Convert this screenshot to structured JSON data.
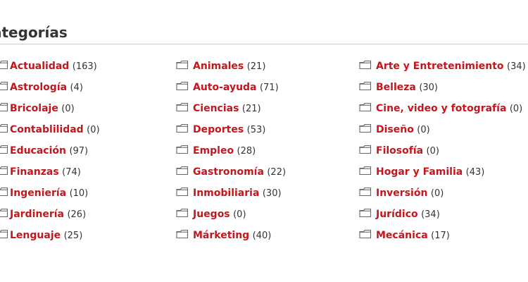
{
  "title": "ategorías",
  "categories": [
    {
      "name": "Actualidad",
      "count": "(163)"
    },
    {
      "name": "Animales",
      "count": "(21)"
    },
    {
      "name": "Arte y Entretenimiento",
      "count": "(34)"
    },
    {
      "name": "Astrología",
      "count": "(4)"
    },
    {
      "name": "Auto-ayuda",
      "count": "(71)"
    },
    {
      "name": "Belleza",
      "count": "(30)"
    },
    {
      "name": "Bricolaje",
      "count": "(0)"
    },
    {
      "name": "Ciencias",
      "count": "(21)"
    },
    {
      "name": "Cine, video y fotografía",
      "count": "(0)"
    },
    {
      "name": "Contablilidad",
      "count": "(0)"
    },
    {
      "name": "Deportes",
      "count": "(53)"
    },
    {
      "name": "Diseño",
      "count": "(0)"
    },
    {
      "name": "Educación",
      "count": "(97)"
    },
    {
      "name": "Empleo",
      "count": "(28)"
    },
    {
      "name": "Filosofía",
      "count": "(0)"
    },
    {
      "name": "Finanzas",
      "count": "(74)"
    },
    {
      "name": "Gastronomía",
      "count": "(22)"
    },
    {
      "name": "Hogar y Familia",
      "count": "(43)"
    },
    {
      "name": "Ingeniería",
      "count": "(10)"
    },
    {
      "name": "Inmobiliaria",
      "count": "(30)"
    },
    {
      "name": "Inversión",
      "count": "(0)"
    },
    {
      "name": "Jardinería",
      "count": "(26)"
    },
    {
      "name": "Juegos",
      "count": "(0)"
    },
    {
      "name": "Jurídico",
      "count": "(34)"
    },
    {
      "name": "Lenguaje",
      "count": "(25)"
    },
    {
      "name": "Márketing",
      "count": "(40)"
    },
    {
      "name": "Mecánica",
      "count": "(17)"
    }
  ],
  "colors": {
    "link": "#c4161c",
    "count": "#333333",
    "divider": "#cfcfcf",
    "folder_icon": "#666666"
  },
  "icons": {
    "category": "folder-icon"
  }
}
